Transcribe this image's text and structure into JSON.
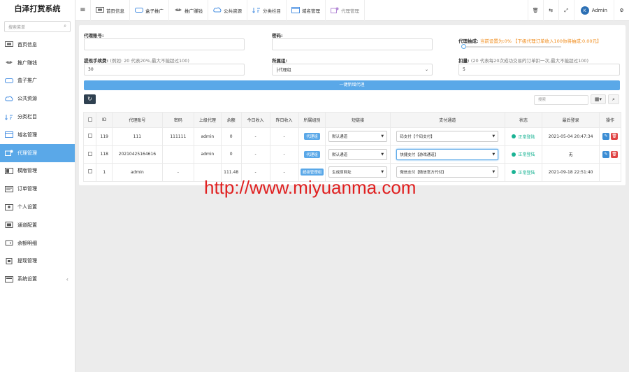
{
  "sidebar": {
    "title": "白泽打赏系统",
    "search_placeholder": "搜索菜单",
    "items": [
      {
        "label": "首页信息",
        "icon": "monitor-icon",
        "active": false
      },
      {
        "label": "推广赚钱",
        "icon": "wings-icon",
        "active": false
      },
      {
        "label": "盒子推广",
        "icon": "box-icon",
        "active": false
      },
      {
        "label": "公共资源",
        "icon": "cloud-icon",
        "active": false
      },
      {
        "label": "分类栏目",
        "icon": "sort-icon",
        "active": false
      },
      {
        "label": "域名管理",
        "icon": "browser-icon",
        "active": false
      },
      {
        "label": "代理管理",
        "icon": "agent-icon",
        "active": true
      },
      {
        "label": "模版管理",
        "icon": "template-icon",
        "active": false
      },
      {
        "label": "订单管理",
        "icon": "order-icon",
        "active": false
      },
      {
        "label": "个人设置",
        "icon": "user-card-icon",
        "active": false
      },
      {
        "label": "通道配置",
        "icon": "channel-icon",
        "active": false
      },
      {
        "label": "余额明细",
        "icon": "wallet-icon",
        "active": false
      },
      {
        "label": "提现管理",
        "icon": "withdraw-icon",
        "active": false
      },
      {
        "label": "系统设置",
        "icon": "settings-icon",
        "active": false
      }
    ]
  },
  "topbar": {
    "tabs": [
      "首页信息",
      "盒子推广",
      "推广赚钱",
      "公共资源",
      "分类栏目",
      "域名管理",
      "代理管理"
    ],
    "user": "Admin"
  },
  "form": {
    "account_label": "代理账号:",
    "password_label": "密码:",
    "commission_label": "代理抽成:",
    "commission_hint": "当前设置为:0% 【下级代理订单收入100你将抽成:0.00元】",
    "commission_value": 0,
    "fee_label": "提现手续费:",
    "fee_hint": "(例如: 20 代表20%,最大不能超过100)",
    "fee_value": "30",
    "group_label": "所属组:",
    "group_value": "├代理组",
    "deduct_label": "扣量:",
    "deduct_hint": "(20 代表每20次成功交易的订单扣一次,最大不能超过100)",
    "deduct_value": "5"
  },
  "add_button": "一键新增代理",
  "table_search_placeholder": "搜索",
  "table": {
    "headers": [
      "ID",
      "代理账号",
      "密码",
      "上级代理",
      "余额",
      "今日收入",
      "昨日收入",
      "所属组别",
      "短链接",
      "支付通道",
      "状态",
      "最后登录",
      "操作"
    ],
    "rows": [
      {
        "id": "119",
        "account": "111",
        "password": "111111",
        "parent": "admin",
        "balance": "0",
        "today": "-",
        "yesterday": "-",
        "group": "代理组",
        "shortlink": "默认通道",
        "payment": "码支付【个码支付】",
        "status": "正常登陆",
        "last_login": "2021-05-04 20:47:34",
        "has_ops": true,
        "payment_focused": false
      },
      {
        "id": "118",
        "account": "20210425164616",
        "password": "",
        "parent": "admin",
        "balance": "0",
        "today": "-",
        "yesterday": "-",
        "group": "代理组",
        "shortlink": "默认通道",
        "payment": "快捷支付【游戏通道】",
        "status": "正常登陆",
        "last_login": "无",
        "has_ops": true,
        "payment_focused": true
      },
      {
        "id": "1",
        "account": "admin",
        "password": "-",
        "parent": "",
        "balance": "111.48",
        "today": "-",
        "yesterday": "-",
        "group": "超级管理组",
        "shortlink": "生成原网址",
        "payment": "微信支付【微信官方代付】",
        "status": "正常登陆",
        "last_login": "2021-09-18 22:51:40",
        "has_ops": false,
        "payment_focused": false
      }
    ]
  },
  "watermark": "http://www.miyuanma.com",
  "colors": {
    "accent": "#5aa8e8",
    "success": "#1ab394",
    "danger": "#e04444",
    "warning": "#f08c1c"
  }
}
